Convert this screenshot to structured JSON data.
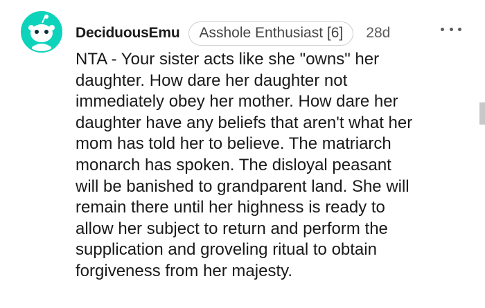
{
  "comment": {
    "username": "DeciduousEmu",
    "flair": "Asshole Enthusiast [6]",
    "age": "28d",
    "avatar_icon": "snoo-avatar-icon",
    "more_icon": "more-options-icon",
    "body_lines": [
      "NTA - Your sister acts like she \"owns\" her",
      "daughter. How dare her daughter not",
      "immediately obey her mother. How dare her",
      "daughter have any beliefs that aren't what her",
      "mom has told her to believe. The matriarch",
      "monarch has spoken. The disloyal peasant",
      "will be banished to grandparent land. She will",
      "remain there until her highness is ready to",
      "allow her subject to return and perform the",
      "supplication and groveling ritual to obtain",
      "forgiveness from her majesty."
    ]
  },
  "colors": {
    "avatar_bg": "#0dd3bb",
    "text": "#1a1a1b",
    "muted": "#5a5a5a",
    "flair_border": "#cfcfcf"
  }
}
